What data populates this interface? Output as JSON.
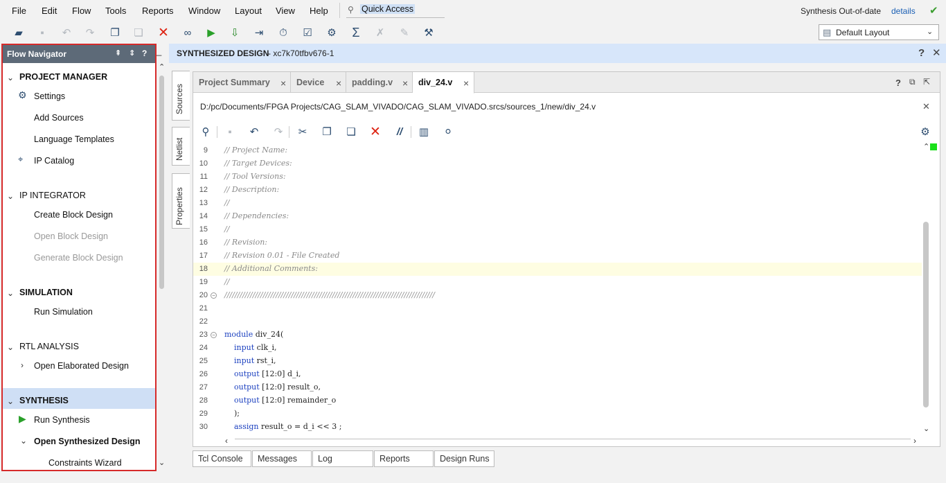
{
  "menu": [
    "File",
    "Edit",
    "Flow",
    "Tools",
    "Reports",
    "Window",
    "Layout",
    "View",
    "Help"
  ],
  "quick_access": "Quick Access",
  "status": {
    "text": "Synthesis Out-of-date",
    "link": "details"
  },
  "layout_select": "Default Layout",
  "flow_navigator": {
    "title": "Flow Navigator",
    "sections": [
      {
        "title": "PROJECT MANAGER",
        "items": [
          "Settings",
          "Add Sources",
          "Language Templates",
          "IP Catalog"
        ]
      },
      {
        "title": "IP INTEGRATOR",
        "items": [
          "Create Block Design",
          "Open Block Design",
          "Generate Block Design"
        ]
      },
      {
        "title": "SIMULATION",
        "items": [
          "Run Simulation"
        ]
      },
      {
        "title": "RTL ANALYSIS",
        "items": [
          "Open Elaborated Design"
        ]
      },
      {
        "title": "SYNTHESIS",
        "items": [
          "Run Synthesis",
          "Open Synthesized Design",
          "Constraints Wizard"
        ]
      }
    ]
  },
  "main_header": {
    "title": "SYNTHESIZED DESIGN",
    "part": "- xc7k70tfbv676-1"
  },
  "side_tabs": [
    "Sources",
    "Netlist",
    "Properties"
  ],
  "editor_tabs": [
    "Project Summary",
    "Device",
    "padding.v",
    "div_24.v"
  ],
  "file_path": "D:/pc/Documents/FPGA Projects/CAG_SLAM_VIVADO/CAG_SLAM_VIVADO.srcs/sources_1/new/div_24.v",
  "code_lines": [
    {
      "n": "9",
      "text": "// Project Name:",
      "type": "comment"
    },
    {
      "n": "10",
      "text": "// Target Devices:",
      "type": "comment"
    },
    {
      "n": "11",
      "text": "// Tool Versions:",
      "type": "comment"
    },
    {
      "n": "12",
      "text": "// Description:",
      "type": "comment"
    },
    {
      "n": "13",
      "text": "//",
      "type": "comment"
    },
    {
      "n": "14",
      "text": "// Dependencies:",
      "type": "comment"
    },
    {
      "n": "15",
      "text": "//",
      "type": "comment"
    },
    {
      "n": "16",
      "text": "// Revision:",
      "type": "comment"
    },
    {
      "n": "17",
      "text": "// Revision 0.01 - File Created",
      "type": "comment"
    },
    {
      "n": "18",
      "text": "// Additional Comments:",
      "type": "comment"
    },
    {
      "n": "19",
      "text": "//",
      "type": "comment"
    },
    {
      "n": "20",
      "text": "//////////////////////////////////////////////////////////////////////////////////",
      "type": "comment"
    },
    {
      "n": "21",
      "text": "",
      "type": "code"
    },
    {
      "n": "22",
      "text": "",
      "type": "code"
    },
    {
      "n": "23",
      "text": "module div_24(",
      "type": "code"
    },
    {
      "n": "24",
      "text": "    input clk_i,",
      "type": "code"
    },
    {
      "n": "25",
      "text": "    input rst_i,",
      "type": "code"
    },
    {
      "n": "26",
      "text": "    output [12:0] d_i,",
      "type": "code"
    },
    {
      "n": "27",
      "text": "    output [12:0] result_o,",
      "type": "code"
    },
    {
      "n": "28",
      "text": "    output [12:0] remainder_o",
      "type": "code"
    },
    {
      "n": "29",
      "text": "    );",
      "type": "code"
    },
    {
      "n": "30",
      "text": "    assign result_o = d_i << 3 ;",
      "type": "code"
    }
  ],
  "bottom_tabs": [
    "Tcl Console",
    "Messages",
    "Log",
    "Reports",
    "Design Runs"
  ]
}
